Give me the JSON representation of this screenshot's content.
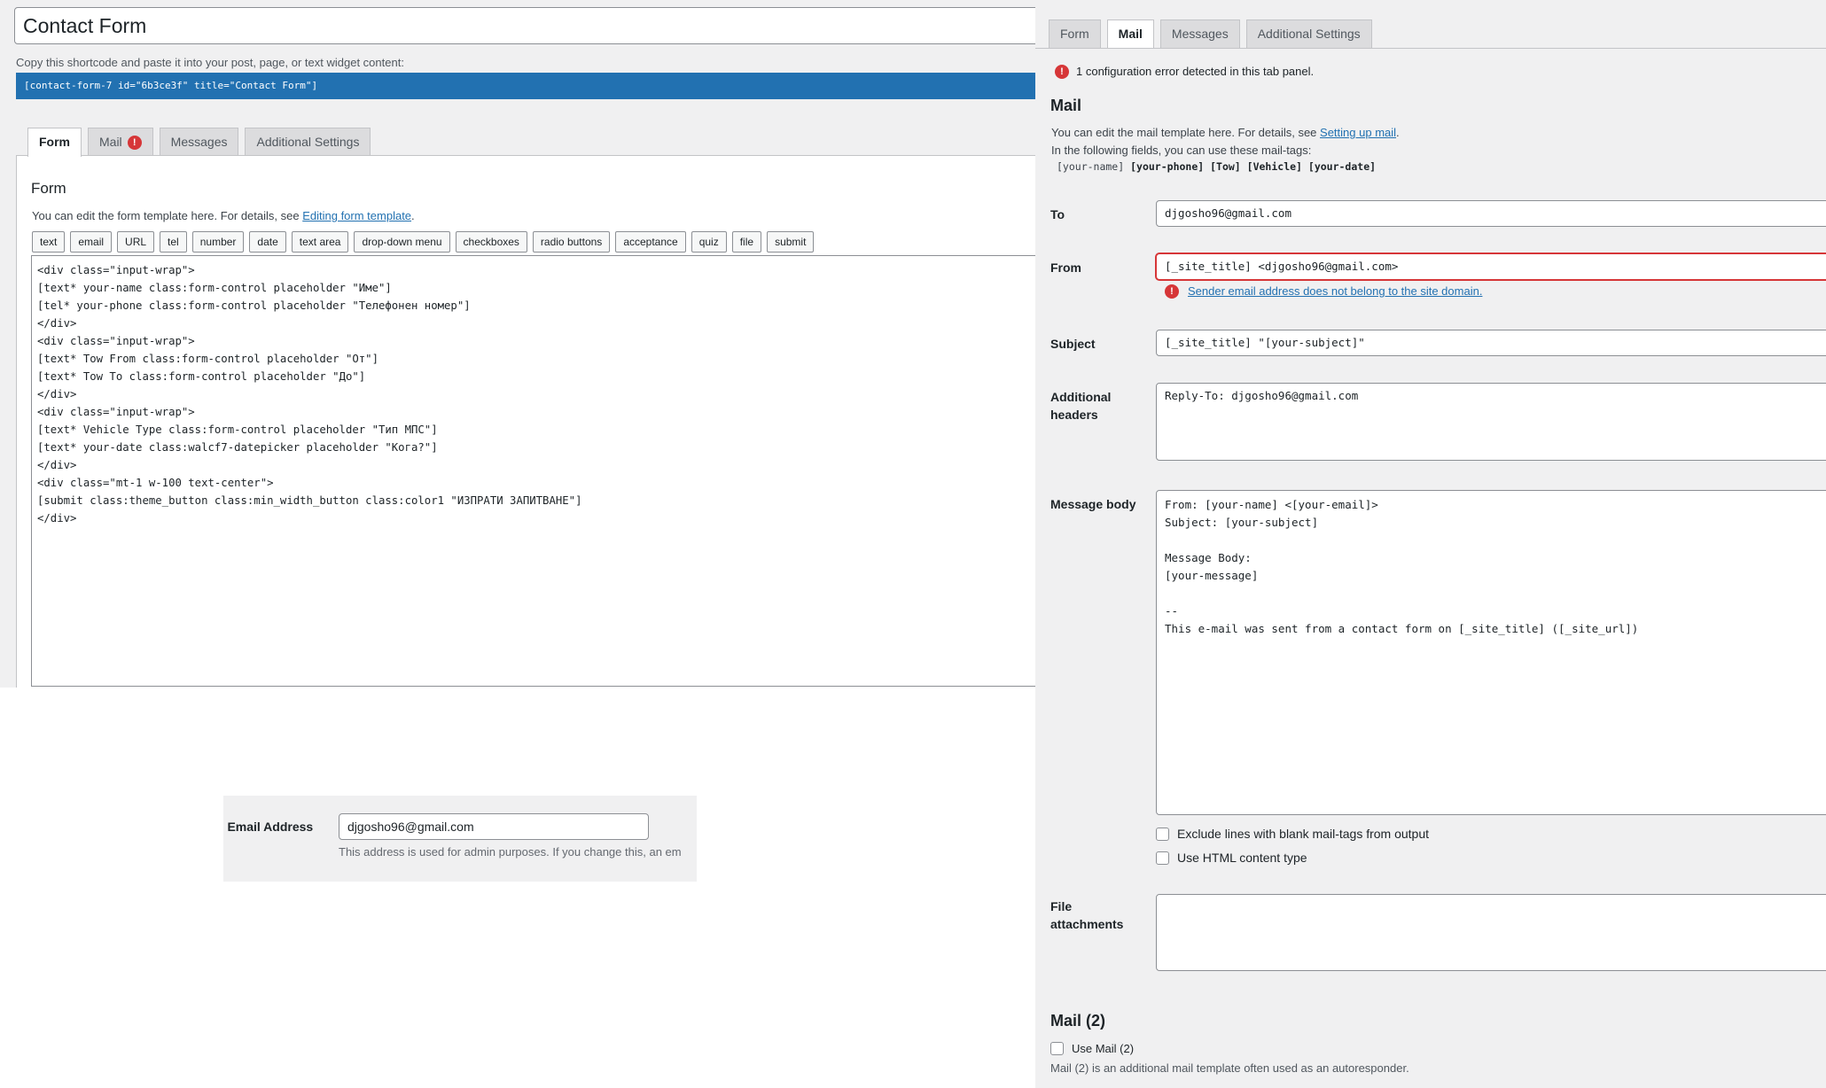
{
  "left": {
    "title": "Contact Form",
    "shortcode_hint": "Copy this shortcode and paste it into your post, page, or text widget content:",
    "shortcode": "[contact-form-7 id=\"6b3ce3f\" title=\"Contact Form\"]",
    "tabs": [
      {
        "label": "Form",
        "active": true
      },
      {
        "label": "Mail",
        "error_badge": "!"
      },
      {
        "label": "Messages"
      },
      {
        "label": "Additional Settings"
      }
    ],
    "form_heading": "Form",
    "form_desc_prefix": "You can edit the form template here. For details, see ",
    "form_desc_link": "Editing form template",
    "form_desc_suffix": ".",
    "tag_buttons": [
      "text",
      "email",
      "URL",
      "tel",
      "number",
      "date",
      "text area",
      "drop-down menu",
      "checkboxes",
      "radio buttons",
      "acceptance",
      "quiz",
      "file",
      "submit"
    ],
    "form_code": "<div class=\"input-wrap\">\n[text* your-name class:form-control placeholder \"Име\"]\n[tel* your-phone class:form-control placeholder \"Телефонен номер\"]\n</div>\n<div class=\"input-wrap\">\n[text* Tow From class:form-control placeholder \"От\"]\n[text* Tow To class:form-control placeholder \"До\"]\n</div>\n<div class=\"input-wrap\">\n[text* Vehicle Type class:form-control placeholder \"Тип МПС\"]\n[text* your-date class:walcf7-datepicker placeholder \"Кога?\"]\n</div>\n<div class=\"mt-1 w-100 text-center\">\n[submit class:theme_button class:min_width_button class:color1 \"ИЗПРАТИ ЗАПИТВАНЕ\"]\n</div>"
  },
  "admin_email": {
    "label": "n Email Address",
    "value": "djgosho96@gmail.com",
    "desc": "This address is used for admin purposes. If you change this, an em"
  },
  "right": {
    "tabs": [
      {
        "label": "Form"
      },
      {
        "label": "Mail",
        "active": true
      },
      {
        "label": "Messages"
      },
      {
        "label": "Additional Settings"
      }
    ],
    "config_error": "1 configuration error detected in this tab panel.",
    "mail_heading": "Mail",
    "mail_desc_prefix": "You can edit the mail template here. For details, see ",
    "mail_desc_link": "Setting up mail",
    "mail_desc_suffix": ".",
    "mail_tags_intro": "In the following fields, you can use these mail-tags:",
    "mail_tags": {
      "plain": "[your-name]",
      "bold": "[your-phone] [Tow] [Vehicle] [your-date]"
    },
    "to_label": "To",
    "to_value": "djgosho96@gmail.com",
    "from_label": "From",
    "from_value": "[_site_title] <djgosho96@gmail.com>",
    "from_error": "Sender email address does not belong to the site domain.",
    "subject_label": "Subject",
    "subject_value": "[_site_title] \"[your-subject]\"",
    "headers_label": "Additional headers",
    "headers_value": "Reply-To: djgosho96@gmail.com",
    "body_label": "Message body",
    "body_value": "From: [your-name] <[your-email]>\nSubject: [your-subject]\n\nMessage Body:\n[your-message]\n\n-- \nThis e-mail was sent from a contact form on [_site_title] ([_site_url])",
    "exclude_blank": "Exclude lines with blank mail-tags from output",
    "use_html": "Use HTML content type",
    "attachments_label": "File attachments",
    "attachments_value": "",
    "mail2_heading": "Mail (2)",
    "use_mail2": "Use Mail (2)",
    "mail2_desc": "Mail (2) is an additional mail template often used as an autoresponder."
  },
  "colors": {
    "accent": "#2271b1",
    "error": "#d63638",
    "background": "#f0f0f1"
  }
}
